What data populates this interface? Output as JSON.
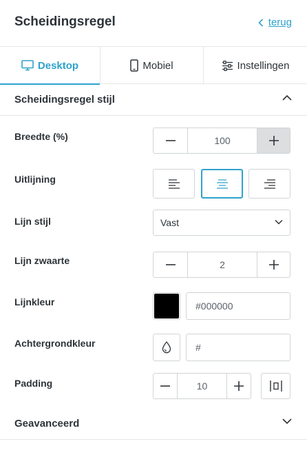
{
  "header": {
    "title": "Scheidingsregel",
    "back_label": "terug"
  },
  "tabs": [
    {
      "label": "Desktop",
      "icon": "desktop-icon",
      "active": true
    },
    {
      "label": "Mobiel",
      "icon": "mobile-icon",
      "active": false
    },
    {
      "label": "Instellingen",
      "icon": "sliders-icon",
      "active": false
    }
  ],
  "section_style": {
    "title": "Scheidingsregel stijl",
    "expanded": true
  },
  "fields": {
    "width": {
      "label": "Breedte (%)",
      "value": "100"
    },
    "alignment": {
      "label": "Uitlijning",
      "options": [
        "align-left",
        "align-center",
        "align-right"
      ],
      "selected": "align-center"
    },
    "line_style": {
      "label": "Lijn stijl",
      "value": "Vast"
    },
    "line_weight": {
      "label": "Lijn zwaarte",
      "value": "2"
    },
    "line_color": {
      "label": "Lijnkleur",
      "value": "#000000",
      "swatch": "#000000"
    },
    "background_color": {
      "label": "Achtergrondkleur",
      "value": "#"
    },
    "padding": {
      "label": "Padding",
      "value": "10"
    }
  },
  "section_advanced": {
    "title": "Geavanceerd",
    "expanded": false
  },
  "colors": {
    "accent": "#2ea2cc",
    "border": "#d0d4d7",
    "text": "#2d3338"
  }
}
